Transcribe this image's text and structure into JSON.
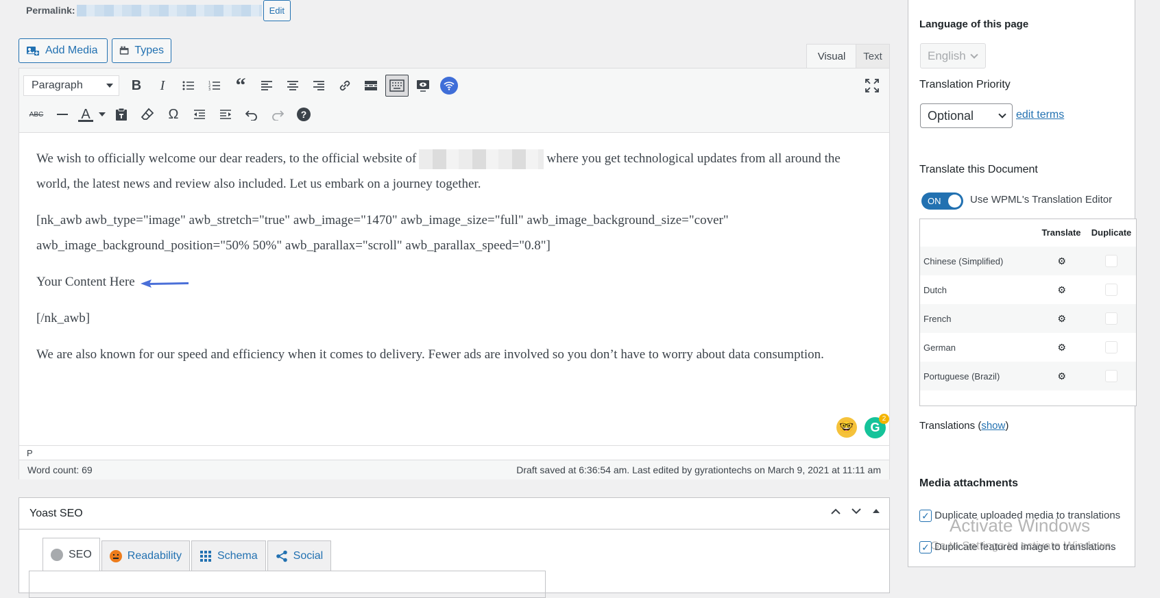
{
  "permalink": {
    "label": "Permalink:",
    "edit_label": "Edit"
  },
  "media_buttons": {
    "add_media": "Add Media",
    "types": "Types"
  },
  "editor_tabs": {
    "visual": "Visual",
    "text": "Text"
  },
  "toolbar": {
    "format_value": "Paragraph",
    "bold": "B",
    "italic": "I",
    "strikethrough": "ABC",
    "text_color": "A",
    "special_char": "Ω",
    "help": "?"
  },
  "content": {
    "p1_before": "We wish to officially welcome our dear readers, to the official website of",
    "p1_after": "where you get technological updates from all around the world, the latest news and review also included. Let us embark on a journey together.",
    "p2": "[nk_awb awb_type=\"image\" awb_stretch=\"true\" awb_image=\"1470\" awb_image_size=\"full\" awb_image_background_size=\"cover\" awb_image_background_position=\"50% 50%\" awb_parallax=\"scroll\" awb_parallax_speed=\"0.8\"]",
    "p3": "Your Content Here",
    "p4": "[/nk_awb]",
    "p5": " We are also known for our speed and efficiency when it comes to delivery. Fewer ads are involved so you don’t have to worry about data consumption."
  },
  "grammarly_badge": "2",
  "path_bar": "P",
  "status": {
    "word_count": "Word count: 69",
    "draft_saved": "Draft saved at 6:36:54 am. Last edited by gyrationtechs on March 9, 2021 at 11:11 am"
  },
  "yoast": {
    "title": "Yoast SEO",
    "tabs": [
      {
        "label": "SEO"
      },
      {
        "label": "Readability"
      },
      {
        "label": "Schema"
      },
      {
        "label": "Social"
      }
    ]
  },
  "sidebar": {
    "language_heading": "Language of this page",
    "language_value": "English",
    "priority_heading": "Translation Priority",
    "priority_value": "Optional",
    "edit_terms": "edit terms",
    "translate_heading": "Translate this Document",
    "toggle_label": "ON",
    "toggle_text": "Use WPML's Translation Editor",
    "table_headers": {
      "translate": "Translate",
      "duplicate": "Duplicate"
    },
    "languages": [
      {
        "name": "Chinese (Simplified)"
      },
      {
        "name": "Dutch"
      },
      {
        "name": "French"
      },
      {
        "name": "German"
      },
      {
        "name": "Portuguese (Brazil)"
      }
    ],
    "translations_label": "Translations (",
    "translations_show": "show",
    "translations_close": ")",
    "media_heading": "Media attachments",
    "dup_media": "Duplicate uploaded media to translations",
    "dup_featured": "Duplicate featured image to translations"
  },
  "watermark": {
    "title": "Activate Windows",
    "subtitle": "Go to Settings to activate Windows."
  },
  "colors": {
    "accent": "#2271b1",
    "wifi_icon": "#3f6ed8",
    "grammarly": "#15c39a"
  }
}
